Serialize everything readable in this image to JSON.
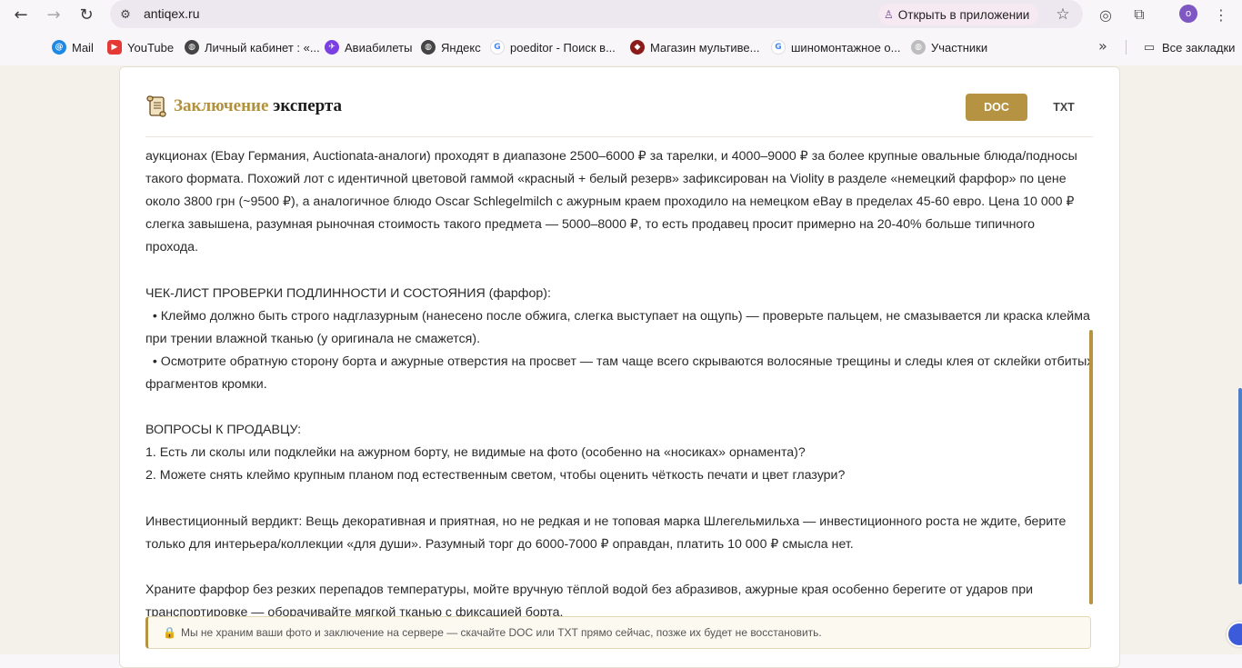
{
  "browser": {
    "url": "antiqex.ru",
    "open_in_app": "Открыть в приложении",
    "profile_initial": "o",
    "bookmarks": [
      {
        "label": "Mail",
        "icon": "at-sign-icon",
        "color": "#1e88e5"
      },
      {
        "label": "YouTube",
        "icon": "youtube-icon",
        "color": "#e53935"
      },
      {
        "label": "Личный кабинет : «...",
        "icon": "globe-icon",
        "color": "#444444"
      },
      {
        "label": "Авиабилеты",
        "icon": "aviasales-icon",
        "color": "#7b3fe4"
      },
      {
        "label": "Яндекс",
        "icon": "globe-icon",
        "color": "#444444"
      },
      {
        "label": "poeditor - Поиск в...",
        "icon": "google-icon",
        "color": "#4285f4"
      },
      {
        "label": "Магазин мультиве...",
        "icon": "shop-icon",
        "color": "#8b1a1a"
      },
      {
        "label": "шиномонтажное о...",
        "icon": "google-icon",
        "color": "#4285f4"
      },
      {
        "label": "Участники",
        "icon": "globe-icon",
        "color": "#9e9e9e"
      }
    ],
    "all_bookmarks": "Все закладки"
  },
  "card": {
    "title_accent": "Заключение",
    "title_rest": "эксперта",
    "doc_label": "DOC",
    "txt_label": "TXT",
    "accent_color": "#b59342"
  },
  "content": {
    "p1_l1": "аукционах (Ebay Германия, Auctionata-аналоги) проходят в диапазоне 2500–6000 ₽ за тарелки, и 4000–9000 ₽ за более крупные овальные блюда/подносы",
    "p1_l2": "такого формата. Похожий лот с идентичной цветовой гаммой «красный + белый резерв» зафиксирован на Violity в разделе «немецкий фарфор» по цене",
    "p1_l3": "около 3800 грн (~9500 ₽), а аналогичное блюдо Oscar Schlegelmilch с ажурным краем проходило на немецком eBay в пределах 45-60 евро. Цена 10 000 ₽",
    "p1_l4": "слегка завышена, разумная рыночная стоимость такого предмета — 5000–8000 ₽, то есть продавец просит примерно на 20-40% больше типичного прохода.",
    "checklist_title": "ЧЕК-ЛИСТ ПРОВЕРКИ ПОДЛИННОСТИ И СОСТОЯНИЯ (фарфор):",
    "check1_l1": "  • Клеймо должно быть строго надглазурным (нанесено после обжига, слегка выступает на ощупь) — проверьте пальцем, не смазывается ли краска клейма",
    "check1_l2": "при трении влажной тканью (у оригинала не смажется).",
    "check2_l1": "  • Осмотрите обратную сторону борта и ажурные отверстия на просвет — там чаще всего скрываются волосяные трещины и следы клея от склейки отбитых",
    "check2_l2": "фрагментов кромки.",
    "questions_title": "ВОПРОСЫ К ПРОДАВЦУ:",
    "q1": "1. Есть ли сколы или подклейки на ажурном борту, не видимые на фото (особенно на «носиках» орнамента)?",
    "q2": "2. Можете снять клеймо крупным планом под естественным светом, чтобы оценить чёткость печати и цвет глазури?",
    "verdict_l1": "Инвестиционный вердикт: Вещь декоративная и приятная, но не редкая и не топовая марка Шлегельмильха — инвестиционного роста не ждите, берите",
    "verdict_l2": "только для интерьера/коллекции «для души». Разумный торг до 6000-7000 ₽ оправдан, платить 10 000 ₽ смысла нет.",
    "care_l1": "Храните фарфор без резких перепадов температуры, мойте вручную тёплой водой без абразивов, ажурные края особенно берегите от ударов при",
    "care_l2": "транспортировке — оборачивайте мягкой тканью с фиксацией борта."
  },
  "notice": "Мы не храним ваши фото и заключение на сервере — скачайте DOC или TXT прямо сейчас, позже их будет не восстановить."
}
